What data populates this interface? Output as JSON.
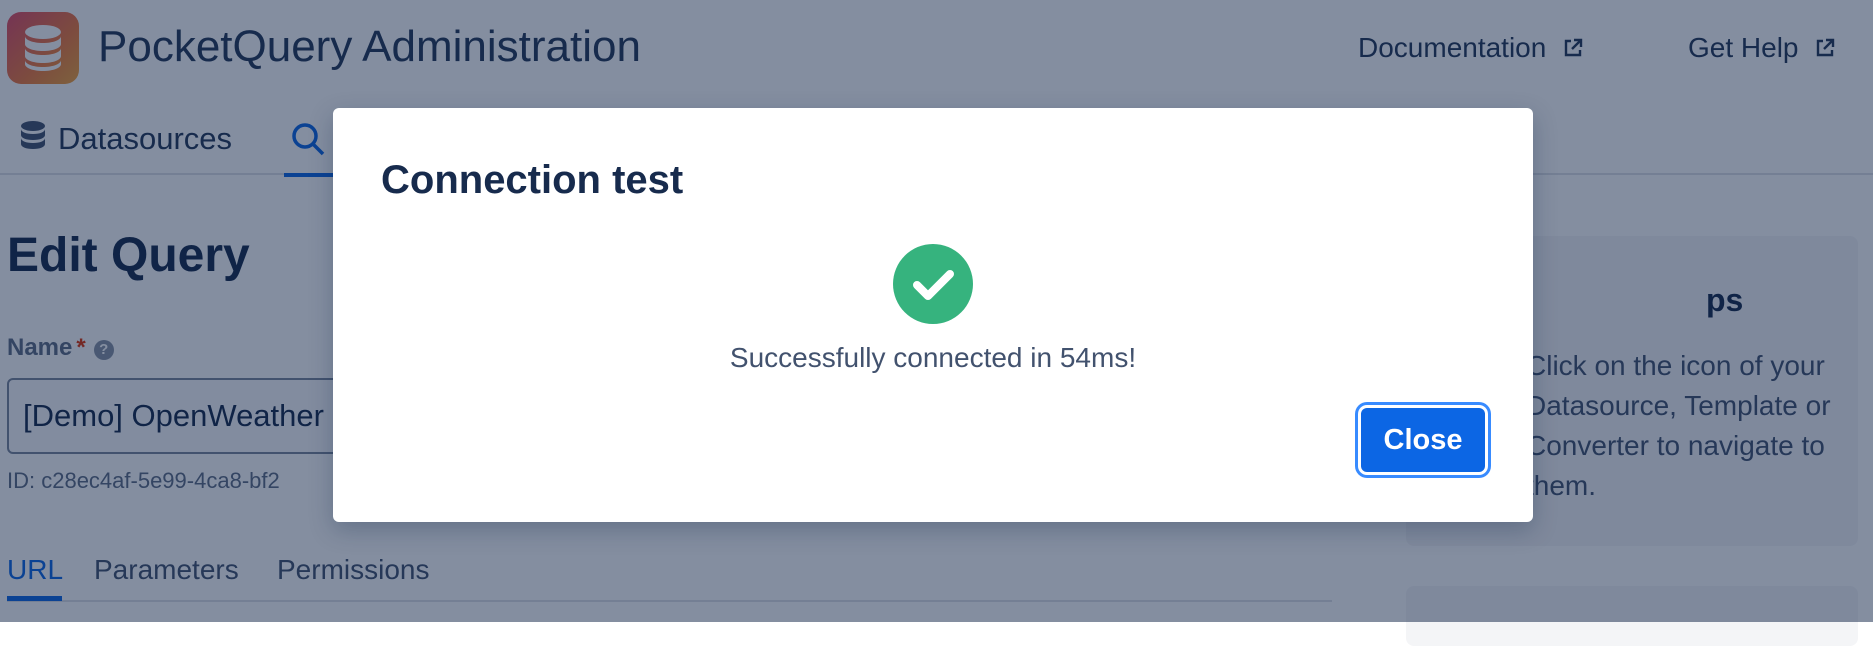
{
  "header": {
    "app_title": "PocketQuery Administration",
    "logo_icon": "database-icon",
    "documentation_label": "Documentation",
    "get_help_label": "Get Help",
    "external_icon": "external-link-icon"
  },
  "nav": {
    "datasources_label": "Datasources",
    "datasources_icon": "database-icon",
    "queries_icon": "search-icon"
  },
  "main": {
    "page_title": "Edit Query",
    "name_label": "Name",
    "required_marker": "*",
    "help_icon_glyph": "?",
    "name_value": "[Demo] OpenWeather",
    "query_id": "ID: c28ec4af-5e99-4ca8-bf2",
    "tabs": [
      {
        "label": "URL",
        "active": true
      },
      {
        "label": "Parameters",
        "active": false
      },
      {
        "label": "Permissions",
        "active": false
      }
    ]
  },
  "tips": {
    "title_fragment": "ps",
    "text": "Click on the icon of your Datasource, Template or Converter to navigate to them."
  },
  "modal": {
    "title": "Connection test",
    "status_icon": "check-circle-icon",
    "message": "Successfully connected in 54ms!",
    "close_label": "Close"
  },
  "colors": {
    "accent": "#0c66e4",
    "success": "#36b37e",
    "overlay": "rgba(9, 30, 66, 0.50)"
  }
}
